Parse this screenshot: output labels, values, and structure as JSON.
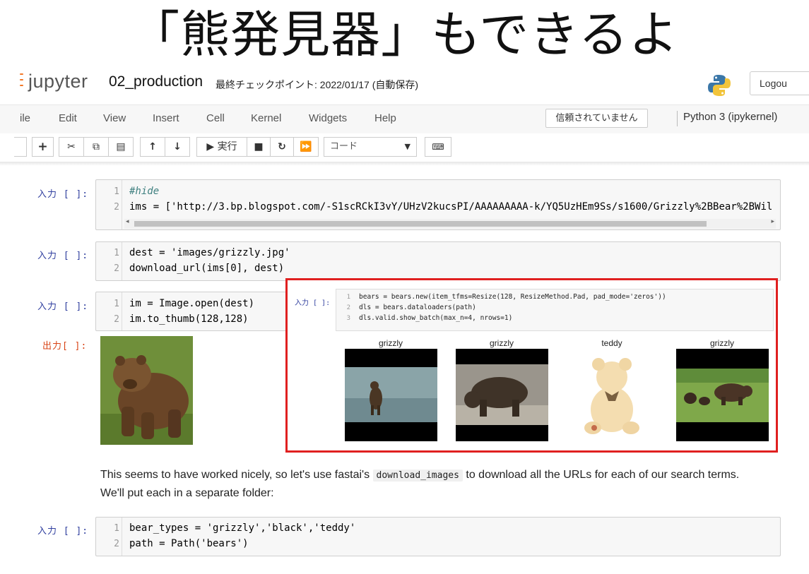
{
  "slide": {
    "title": "「熊発見器」もできるよ"
  },
  "header": {
    "app_name": "jupyter",
    "notebook_name": "02_production",
    "checkpoint": "最終チェックポイント: 2022/01/17  (自動保存)",
    "logout_label": "Logou"
  },
  "menu": {
    "items": [
      "ile",
      "Edit",
      "View",
      "Insert",
      "Cell",
      "Kernel",
      "Widgets",
      "Help"
    ],
    "trust": "信頼されていません",
    "kernel": "Python 3 (ipykernel)"
  },
  "toolbar": {
    "run_label": "実行",
    "cell_type": "コード"
  },
  "cells": [
    {
      "prompt": "入力 [ ]:",
      "lines": [
        "#hide",
        "ims = ['http://3.bp.blogspot.com/-S1scRCkI3vY/UHzV2kucsPI/AAAAAAAAA-k/YQ5UzHEm9Ss/s1600/Grizzly%2BBear%2BWil"
      ]
    },
    {
      "prompt": "入力 [ ]:",
      "lines": [
        "dest = 'images/grizzly.jpg'",
        "download_url(ims[0], dest)"
      ]
    },
    {
      "prompt": "入力 [ ]:",
      "lines": [
        "im = Image.open(dest)",
        "im.to_thumb(128,128)"
      ]
    },
    {
      "prompt": "出力[ ]:"
    },
    {
      "prompt": "入力 [ ]:",
      "lines": [
        "bear_types = 'grizzly','black','teddy'",
        "path = Path('bears')"
      ]
    }
  ],
  "markdown": {
    "before": "This seems to have worked nicely, so let's use fastai's ",
    "code": "download_images",
    "after": " to download all the URLs for each of our search terms. We'll put each in a separate folder:"
  },
  "overlay": {
    "prompt": "入力 [ ]:",
    "lines": [
      "bears = bears.new(item_tfms=Resize(128, ResizeMethod.Pad, pad_mode='zeros'))",
      "dls = bears.dataloaders(path)",
      "dls.valid.show_batch(max_n=4, nrows=1)"
    ],
    "labels": [
      "grizzly",
      "grizzly",
      "teddy",
      "grizzly"
    ]
  },
  "line_numbers": [
    "1",
    "2",
    "3"
  ],
  "colors": {
    "highlight_border": "#e02020",
    "prompt_in": "#303f9f",
    "prompt_out": "#d84315"
  }
}
